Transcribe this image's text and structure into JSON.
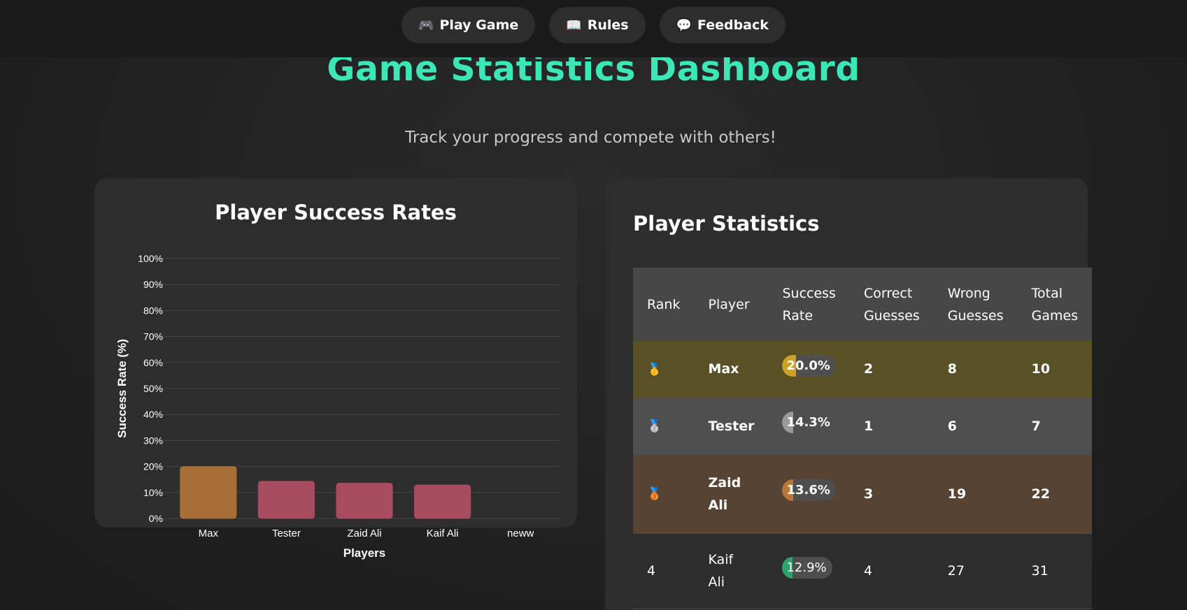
{
  "nav": {
    "items": [
      {
        "icon": "🎮",
        "label": "Play Game"
      },
      {
        "icon": "📖",
        "label": "Rules"
      },
      {
        "icon": "💬",
        "label": "Feedback"
      }
    ]
  },
  "header": {
    "title": "Game Statistics Dashboard",
    "subtitle": "Track your progress and compete with others!"
  },
  "chart_card": {
    "title": "Player Success Rates"
  },
  "chart_data": {
    "type": "bar",
    "title": "Player Success Rates",
    "categories": [
      "Max",
      "Tester",
      "Zaid Ali",
      "Kaif Ali",
      "neww"
    ],
    "values": [
      20.0,
      14.3,
      13.6,
      12.9,
      0
    ],
    "bar_colors": [
      "#a86e37",
      "#a84c5f",
      "#a84c5f",
      "#a84c5f",
      "#a84c5f"
    ],
    "xlabel": "Players",
    "ylabel": "Success Rate (%)",
    "ylim": [
      0,
      100
    ],
    "yticks": [
      "0%",
      "10%",
      "20%",
      "30%",
      "40%",
      "50%",
      "60%",
      "70%",
      "80%",
      "90%",
      "100%"
    ],
    "grid": true
  },
  "table_card": {
    "title": "Player Statistics",
    "columns": [
      [
        "Rank"
      ],
      [
        "Player"
      ],
      [
        "Success",
        "Rate"
      ],
      [
        "Correct",
        "Guesses"
      ],
      [
        "Wrong",
        "Guesses"
      ],
      [
        "Total",
        "Games"
      ]
    ],
    "rows": [
      {
        "rank": "🥇",
        "player": "Max",
        "rate": "20.0%",
        "rate_value": 20.0,
        "rate_color": "#c9a227",
        "correct": "2",
        "wrong": "8",
        "total": "10"
      },
      {
        "rank": "🥈",
        "player": "Tester",
        "rate": "14.3%",
        "rate_value": 14.3,
        "rate_color": "#9a9a9a",
        "correct": "1",
        "wrong": "6",
        "total": "7"
      },
      {
        "rank": "🥉",
        "player": "Zaid Ali",
        "rate": "13.6%",
        "rate_value": 13.6,
        "rate_color": "#b7783a",
        "correct": "3",
        "wrong": "19",
        "total": "22"
      },
      {
        "rank": "4",
        "player": "Kaif Ali",
        "rate": "12.9%",
        "rate_value": 12.9,
        "rate_color": "#2fa36b",
        "correct": "4",
        "wrong": "27",
        "total": "31"
      }
    ]
  },
  "colors": {
    "accent": "#3ce6b6",
    "background": "#232323",
    "card": "#2d2d2d"
  }
}
